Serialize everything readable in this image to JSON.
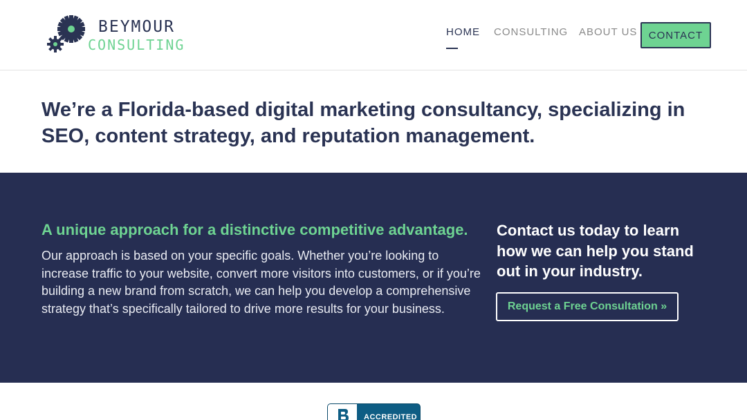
{
  "header": {
    "logo": {
      "name": "BEYMOUR",
      "sub": "CONSULTING"
    },
    "nav": [
      {
        "label": "HOME"
      },
      {
        "label": "CONSULTING"
      },
      {
        "label": "ABOUT US"
      }
    ],
    "contact_label": "CONTACT"
  },
  "intro": {
    "text": "We’re a Florida-based digital marketing consultancy, specializing in SEO, content strategy, and reputation management."
  },
  "approach": {
    "title": "A unique approach for a distinctive competitive advantage.",
    "body": "Our approach is based on your specific goals. Whether you’re looking to increase traffic to your website, convert more visitors into customers, or if you’re building a new brand from scratch, we can help you develop a comprehensive strategy that’s specifically tailored to drive more results for your business."
  },
  "cta": {
    "heading": "Contact us today to learn how we can help you stand out in your industry.",
    "button_label": "Request a Free Consultation »"
  },
  "badge": {
    "label": "ACCREDITED"
  },
  "colors": {
    "navy": "#262e52",
    "text_navy": "#2a3353",
    "accent_green": "#6ed392",
    "badge_blue": "#0e5d84"
  },
  "icons": [
    "gear-logo-icon",
    "bbb-seal-icon"
  ]
}
